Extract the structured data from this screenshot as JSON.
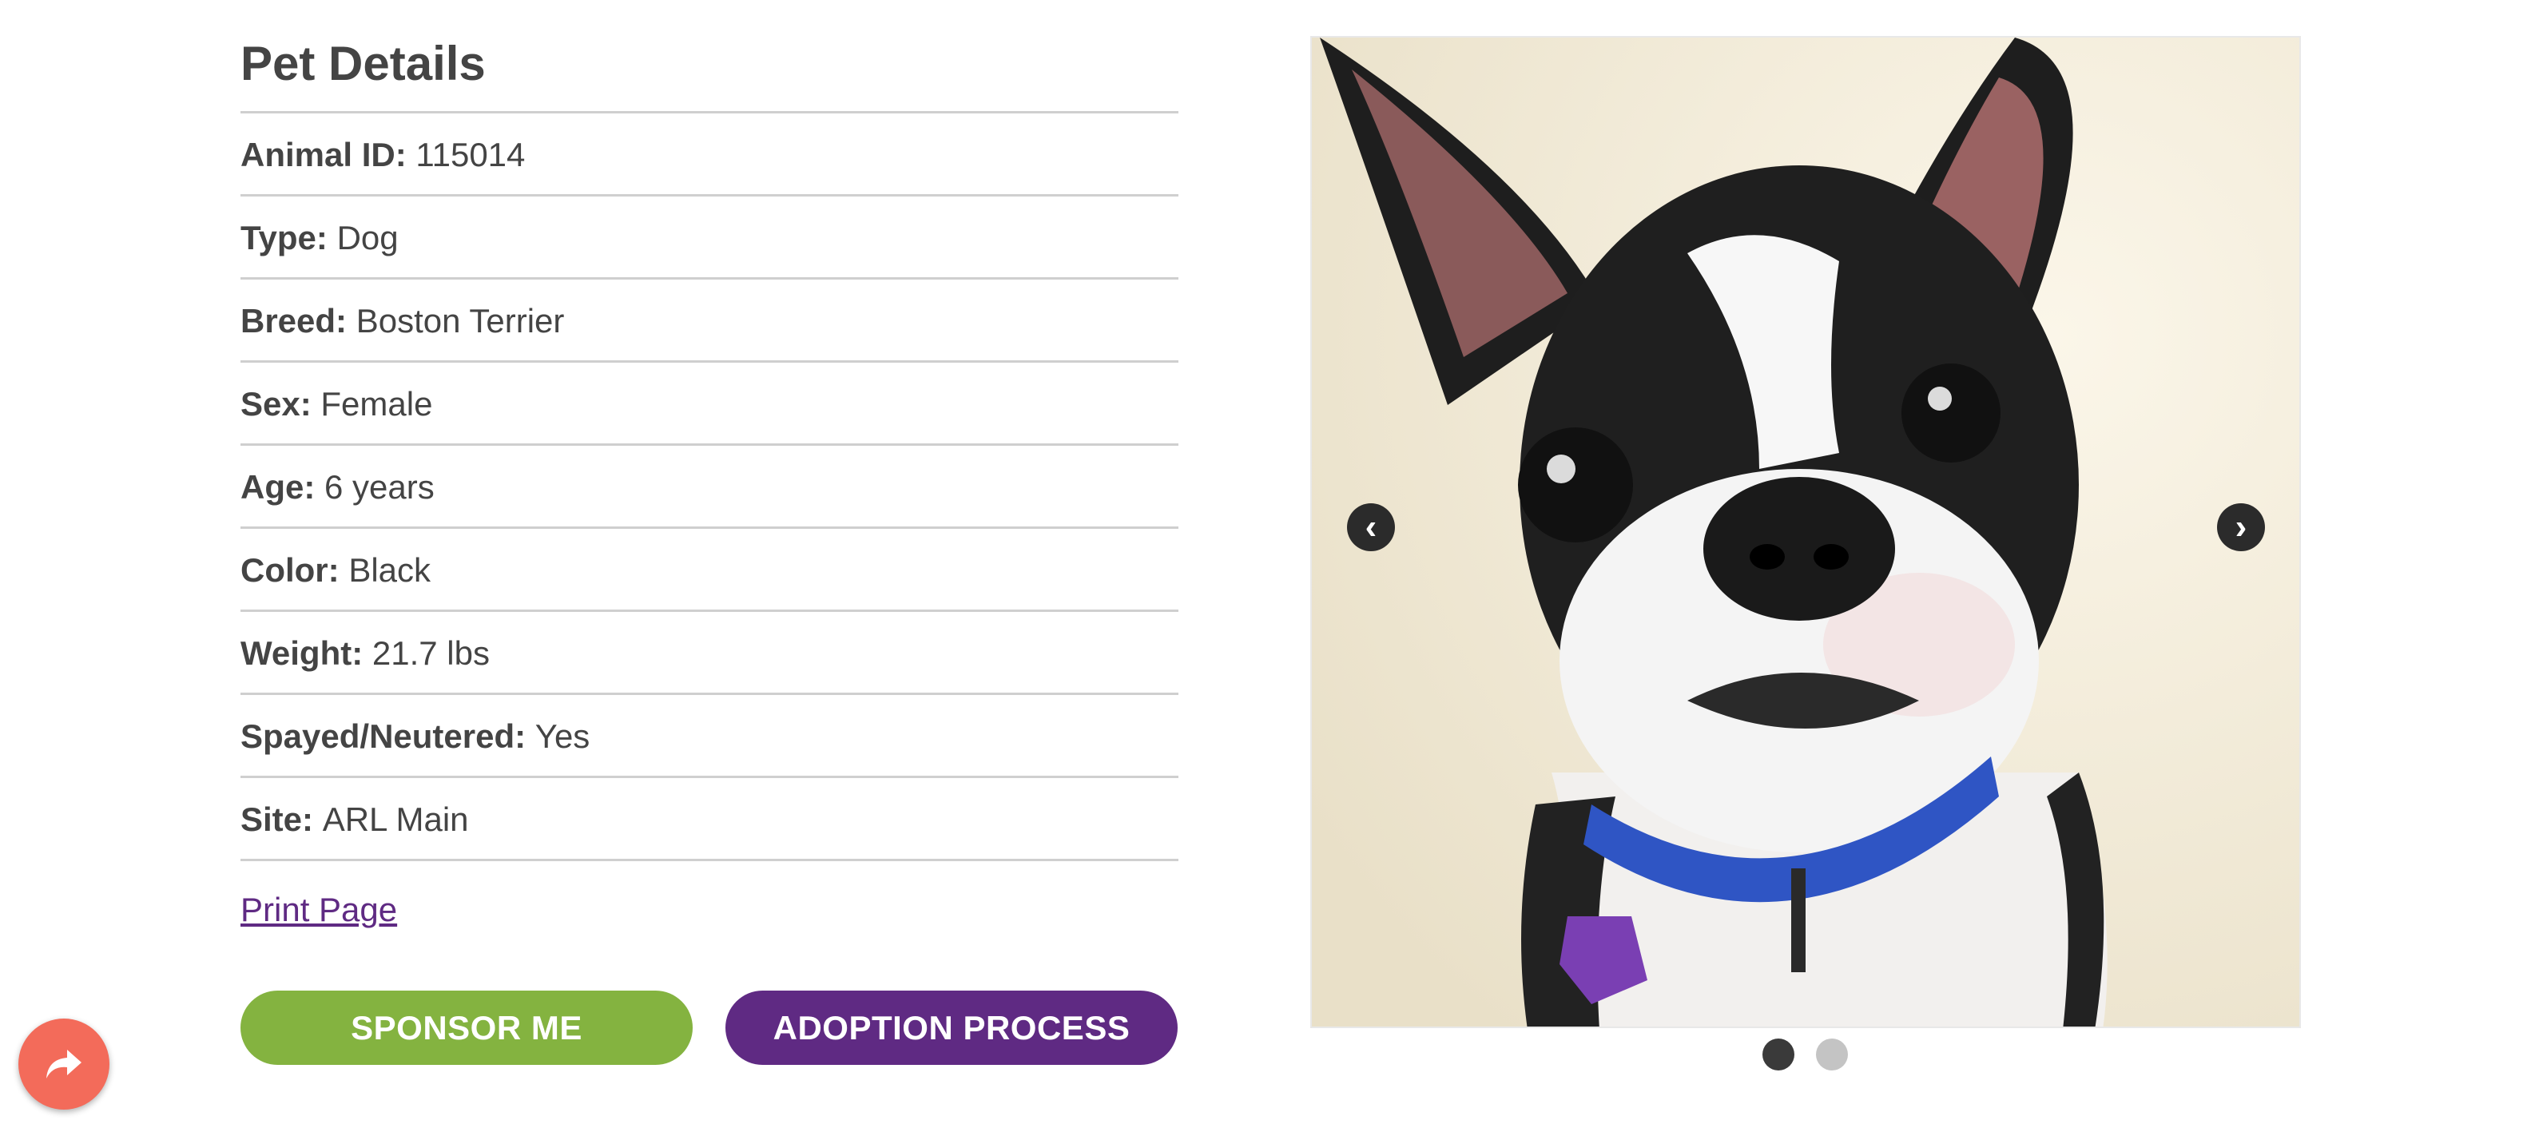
{
  "pet_details": {
    "title": "Pet Details",
    "fields": [
      {
        "label": "Animal ID:",
        "value": "115014"
      },
      {
        "label": "Type:",
        "value": "Dog"
      },
      {
        "label": "Breed:",
        "value": "Boston Terrier"
      },
      {
        "label": "Sex:",
        "value": "Female"
      },
      {
        "label": "Age:",
        "value": "6 years"
      },
      {
        "label": "Color:",
        "value": "Black"
      },
      {
        "label": "Weight:",
        "value": "21.7 lbs"
      },
      {
        "label": "Spayed/Neutered:",
        "value": "Yes"
      },
      {
        "label": "Site:",
        "value": "ARL Main"
      }
    ]
  },
  "actions": {
    "print_label": "Print Page",
    "sponsor_label": "SPONSOR ME",
    "adopt_label": "ADOPTION PROCESS"
  },
  "gallery": {
    "prev_icon": "chevron-left-icon",
    "next_icon": "chevron-right-icon",
    "slide_count": 2,
    "active_slide": 1
  },
  "share": {
    "icon": "share-arrow-icon"
  },
  "colors": {
    "sponsor": "#84b340",
    "adopt": "#5f2a83",
    "link": "#5f2a83",
    "share": "#f36b5a",
    "dot_active": "#3a3a3a",
    "dot_inactive": "#c4c4c4"
  }
}
